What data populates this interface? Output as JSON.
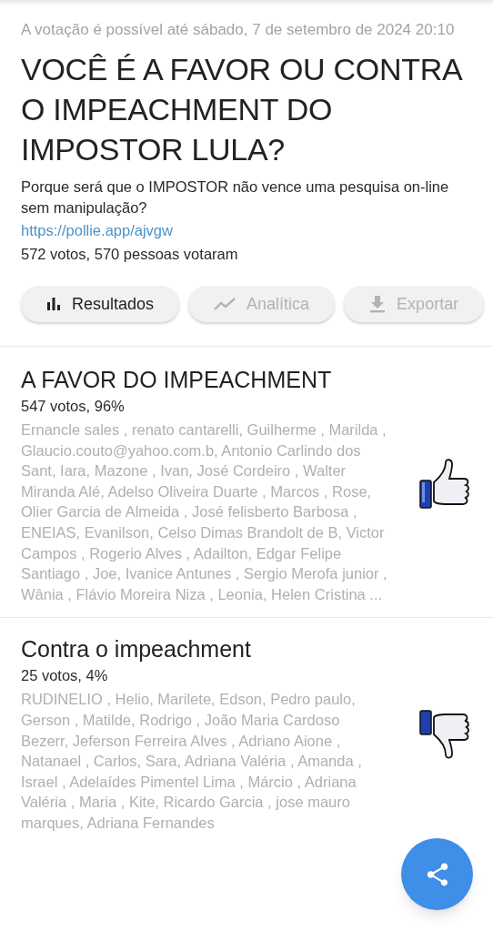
{
  "deadline": "A votação é possível até sábado, 7 de setembro de 2024 20:10",
  "title": "VOCÊ É  A FAVOR OU CONTRA O IMPEACHMENT DO IMPOSTOR LULA?",
  "description": "Porque será que o IMPOSTOR não vence uma pesquisa on-line sem manipulação?",
  "link": "https://pollie.app/ajvgw",
  "summary": "572 votos, 570 pessoas votaram",
  "actions": [
    {
      "kind": "bars",
      "label": "Resultados",
      "selected": true
    },
    {
      "kind": "trend",
      "label": "Analítica",
      "selected": false
    },
    {
      "kind": "download",
      "label": "Exportar",
      "selected": false
    }
  ],
  "options": [
    {
      "kind": "up",
      "title": "A FAVOR DO IMPEACHMENT",
      "votes": "547 votos, 96%",
      "voters": "Ernancle sales , renato cantarelli, Guilherme , Marilda , Glaucio.couto@yahoo.com.b, Antonio Carlindo dos Sant, Iara, Mazone , Ivan, José Cordeiro , Walter Miranda Alé, Adelso Oliveira Duarte , Marcos , Rose, Olier Garcia de Almeida , José felisberto Barbosa , ENEIAS, Evanilson, Celso Dimas Brandolt de B, Victor Campos , Rogerio Alves , Adailton, Edgar Felipe Santiago , Joe, Ivanice Antunes , Sergio Merofa junior , Wânia , Flávio Moreira Niza , Leonia, Helen Cristina  ..."
    },
    {
      "kind": "down",
      "title": "Contra o impeachment",
      "votes": "25 votos, 4%",
      "voters": "RUDINELIO , Helio, Marilete, Edson, Pedro paulo, Gerson , Matilde, Rodrigo , João Maria Cardoso Bezerr, Jeferson Ferreira Alves , Adriano Aione , Natanael , Carlos, Sara, Adriana Valéria , Amanda , Israel , Adelaídes Pimentel Lima , Márcio , Adriana Valéria , Maria , Kite, Ricardo Garcia , jose mauro marques, Adriana Fernandes"
    }
  ]
}
